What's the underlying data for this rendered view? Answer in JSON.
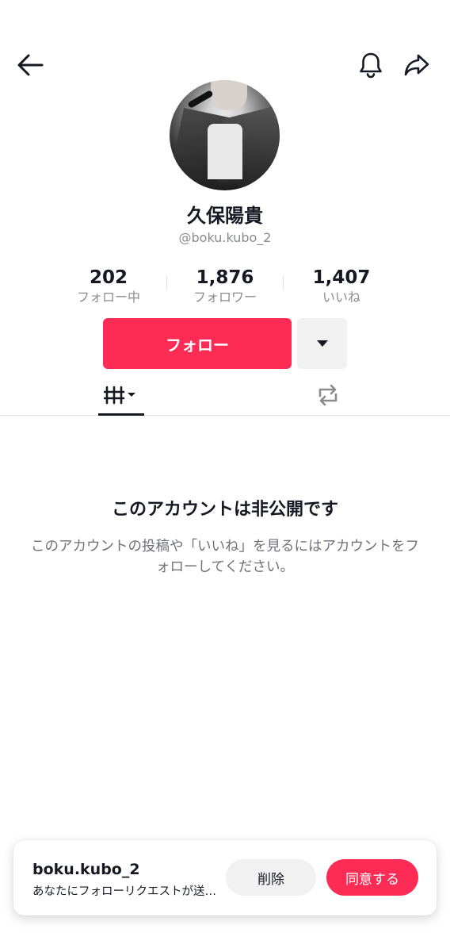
{
  "header": {
    "back_icon": "arrow-left-icon",
    "notification_icon": "bell-icon",
    "share_icon": "share-arrow-icon"
  },
  "profile": {
    "display_name": "久保陽貴",
    "username": "@boku.kubo_2"
  },
  "stats": [
    {
      "value": "202",
      "label": "フォロー中"
    },
    {
      "value": "1,876",
      "label": "フォロワー"
    },
    {
      "value": "1,407",
      "label": "いいね"
    }
  ],
  "actions": {
    "follow_label": "フォロー",
    "more_icon": "caret-down-icon"
  },
  "tabs": [
    {
      "icon": "grid-icon",
      "active": true
    },
    {
      "icon": "repost-icon",
      "active": false
    }
  ],
  "private": {
    "title": "このアカウントは非公開です",
    "description": "このアカウントの投稿や「いいね」を見るにはアカウントをフォローしてください。"
  },
  "follow_request": {
    "username": "boku.kubo_2",
    "message": "あなたにフォローリクエストが送信されました",
    "delete_label": "削除",
    "accept_label": "同意する"
  },
  "colors": {
    "accent": "#fe2c55",
    "text_primary": "#161823",
    "text_secondary": "#8a8b91",
    "button_gray": "#f1f1f2"
  }
}
